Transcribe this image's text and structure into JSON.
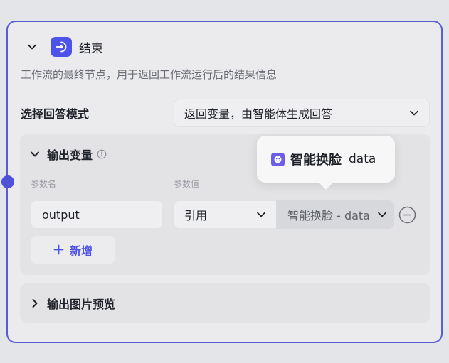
{
  "node": {
    "title": "结束",
    "description": "工作流的最终节点，用于返回工作流运行后的结果信息"
  },
  "answer_mode": {
    "label": "选择回答模式",
    "selected": "返回变量，由智能体生成回答"
  },
  "output_vars": {
    "title": "输出变量",
    "col_name_label": "参数名",
    "col_value_label": "参数值",
    "rows": [
      {
        "name": "output",
        "value_type": "引用",
        "source": "智能换脸 - data"
      }
    ],
    "add_label": "新增"
  },
  "image_preview": {
    "title": "输出图片预览"
  },
  "tooltip": {
    "node_name": "智能换脸",
    "field": "data"
  },
  "colors": {
    "accent": "#4d53e8",
    "border": "#5b5bd6",
    "connector": "#4f51d6"
  }
}
